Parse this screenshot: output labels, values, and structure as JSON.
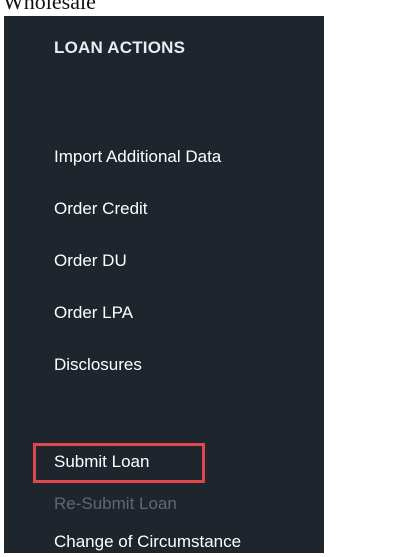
{
  "caption": "Wholesale",
  "panel": {
    "title": "LOAN ACTIONS",
    "items": [
      {
        "label": "Import Additional Data",
        "enabled": true
      },
      {
        "label": "Order Credit",
        "enabled": true
      },
      {
        "label": "Order DU",
        "enabled": true
      },
      {
        "label": "Order LPA",
        "enabled": true
      },
      {
        "label": "Disclosures",
        "enabled": true
      },
      {
        "label": "Submit Loan",
        "enabled": true,
        "highlighted": true
      },
      {
        "label": "Re-Submit Loan",
        "enabled": false
      },
      {
        "label": "Change of Circumstance",
        "enabled": true
      }
    ]
  },
  "colors": {
    "panel_bg": "#1e252d",
    "text": "#ffffff",
    "disabled_text": "#5d6875",
    "highlight": "#e0474c"
  }
}
